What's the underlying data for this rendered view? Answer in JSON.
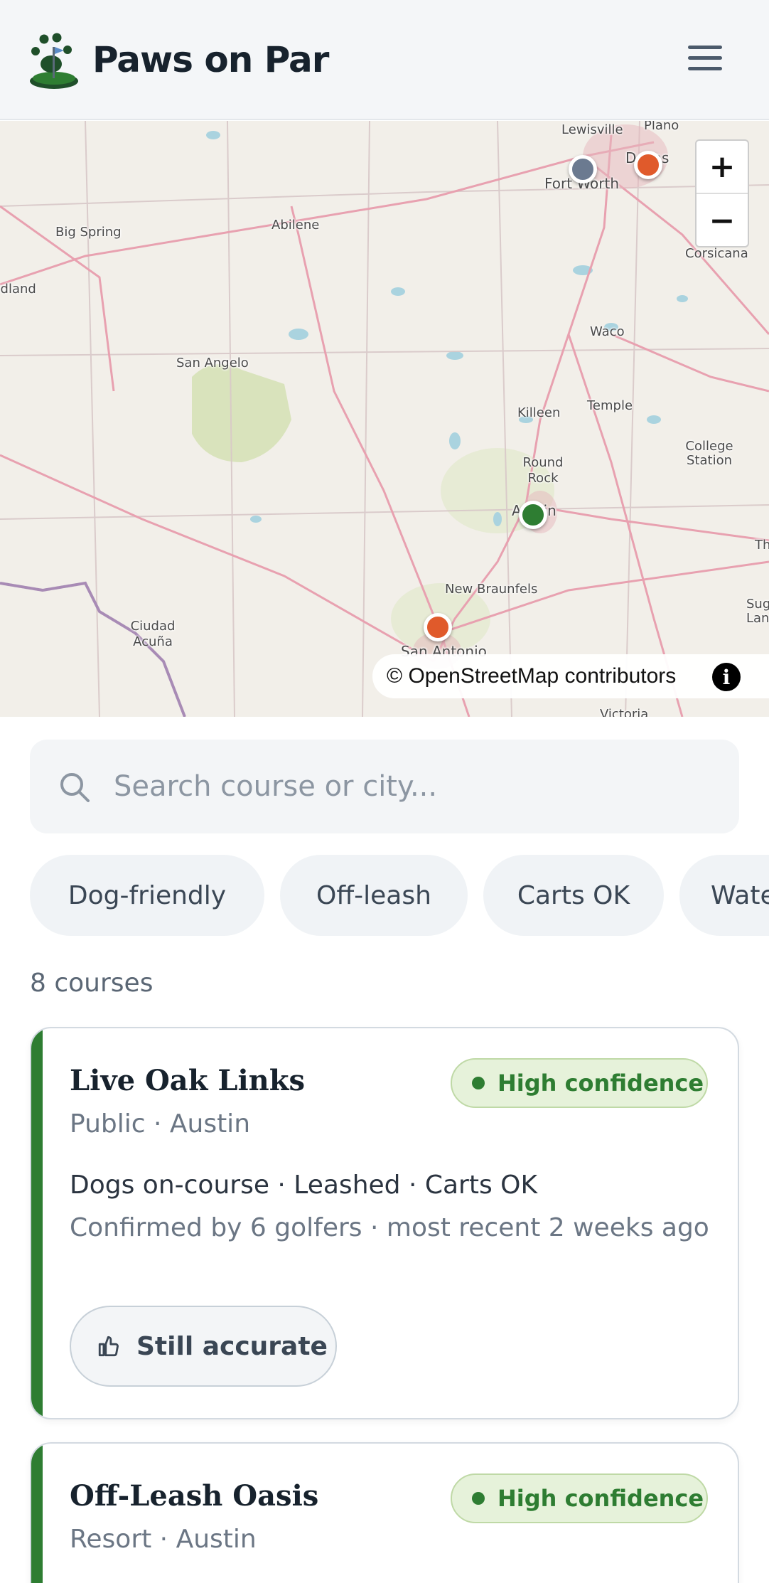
{
  "app": {
    "name": "Paws on Par"
  },
  "header": {
    "menu_icon": "hamburger-menu-icon",
    "logo_icon": "paw-flag-logo-icon"
  },
  "map": {
    "labels": [
      "Lewisville",
      "Plano",
      "Fort Worth",
      "Dallas",
      "Big Spring",
      "Abilene",
      "Midland",
      "Corsicana",
      "Waco",
      "San Angelo",
      "Killeen",
      "Temple",
      "College Station",
      "Round Rock",
      "Austin",
      "New Braunfels",
      "Ciudad Acuña",
      "San Antonio",
      "Victoria",
      "Sugar Land",
      "Th"
    ],
    "zoom_in": "+",
    "zoom_out": "−",
    "attribution": "© OpenStreetMap contributors",
    "info_icon": "i",
    "markers": [
      {
        "name": "fort-worth-marker",
        "color": "#6b7a90"
      },
      {
        "name": "dallas-marker",
        "color": "#e05a2b"
      },
      {
        "name": "austin-marker",
        "color": "#2e7d32"
      },
      {
        "name": "san-antonio-marker",
        "color": "#e05a2b"
      }
    ]
  },
  "search": {
    "placeholder": "Search course or city..."
  },
  "filters": [
    "Dog-friendly",
    "Off-leash",
    "Carts OK",
    "Water"
  ],
  "results": {
    "count_label": "8 courses"
  },
  "courses": [
    {
      "name": "Live Oak Links",
      "type_city": "Public · Austin",
      "confidence": "High confidence",
      "policy": "Dogs on-course · Leashed · Carts OK",
      "confirmation": "Confirmed by 6 golfers · most recent 2 weeks ago",
      "action": "Still accurate"
    },
    {
      "name": "Off-Leash Oasis",
      "type_city": "Resort · Austin",
      "confidence": "High confidence"
    }
  ],
  "colors": {
    "accent": "#2e7d32",
    "marker_orange": "#e05a2b",
    "marker_gray": "#6b7a90"
  }
}
